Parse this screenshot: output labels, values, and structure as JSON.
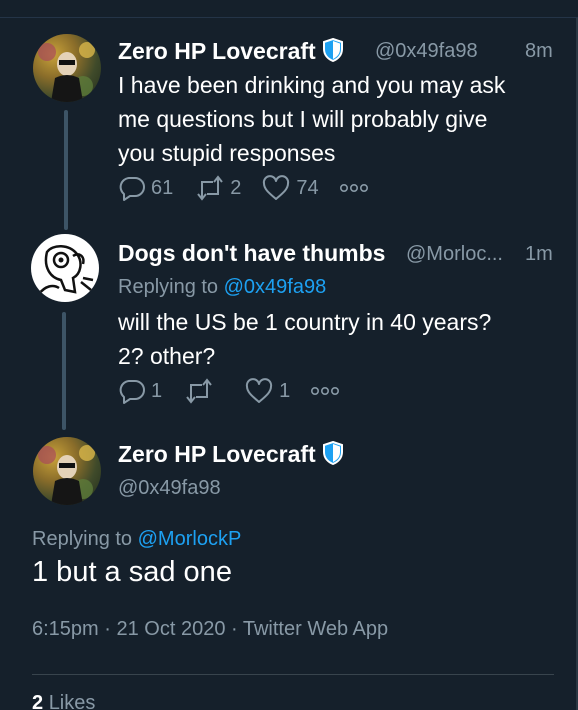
{
  "tweets": [
    {
      "name": "Zero HP Lovecraft",
      "handle": "@0x49fa98",
      "time": "8m",
      "text_lines": [
        "I have been drinking and you may ask",
        "me questions but I will probably give",
        "you stupid responses"
      ],
      "replies": "61",
      "retweets": "2",
      "likes": "74"
    },
    {
      "name": "Dogs don't have thumbs",
      "handle": "@Morloc...",
      "time": "1m",
      "replying_label": "Replying to",
      "replying_to": "@0x49fa98",
      "text_lines": [
        "will the US be 1 country in 40 years?",
        "2? other?"
      ],
      "replies": "1",
      "likes": "1"
    }
  ],
  "main": {
    "name": "Zero HP Lovecraft",
    "handle": "@0x49fa98",
    "replying_label": "Replying to",
    "replying_to": "@MorlockP",
    "text": "1 but a sad one",
    "meta": "6:15pm · 21 Oct 2020 · Twitter Web App",
    "likes_count": "2",
    "likes_label": "Likes"
  },
  "colors": {
    "background": "#15202b",
    "secondary_text": "#8899a6",
    "link": "#1da1f2",
    "verified": "#1da1f2"
  },
  "icons": [
    "reply-icon",
    "retweet-icon",
    "like-icon",
    "more-icon",
    "verified-shield-icon"
  ]
}
